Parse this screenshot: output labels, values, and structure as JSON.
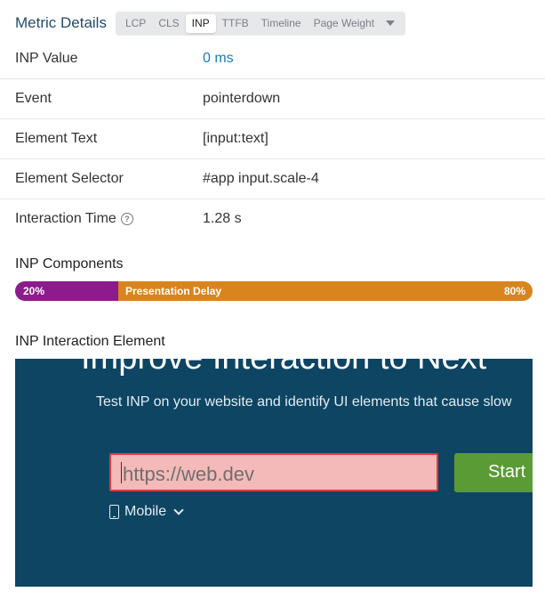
{
  "header": {
    "title": "Metric Details",
    "tabs": [
      "LCP",
      "CLS",
      "INP",
      "TTFB",
      "Timeline",
      "Page Weight"
    ],
    "active_tab": "INP"
  },
  "details": [
    {
      "label": "INP Value",
      "value": "0 ms"
    },
    {
      "label": "Event",
      "value": "pointerdown"
    },
    {
      "label": "Element Text",
      "value": "[input:text]"
    },
    {
      "label": "Element Selector",
      "value": "#app input.scale-4"
    },
    {
      "label": "Interaction Time",
      "value": "1.28 s"
    }
  ],
  "components": {
    "title": "INP Components",
    "segments": [
      {
        "label": "20%",
        "percent": 20,
        "color": "#8c1b8c"
      },
      {
        "label": "Presentation Delay",
        "value_label": "80%",
        "percent": 80,
        "color": "#d9841d"
      }
    ]
  },
  "element": {
    "title": "INP Interaction Element",
    "screenshot": {
      "heading": "Improve Interaction to Next",
      "subheading": "Test INP on your website and identify UI elements that cause slow",
      "input_placeholder": "https://web.dev",
      "button_label": "Start",
      "device_label": "Mobile"
    }
  },
  "colors": {
    "title": "#1f4d6b",
    "link": "#1a7cb8",
    "screenshot_bg": "#0e4563",
    "start_button": "#5b9b35",
    "highlight": "#e23b3b"
  }
}
